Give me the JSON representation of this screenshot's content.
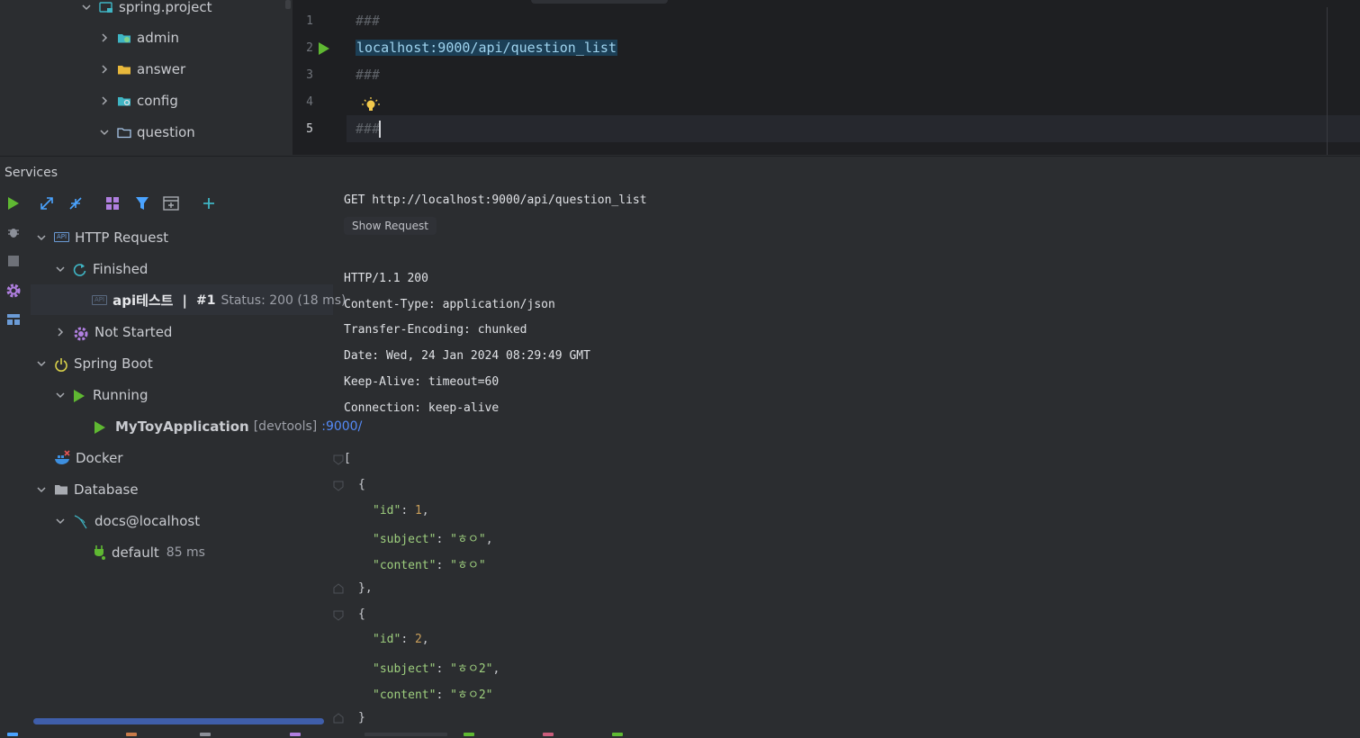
{
  "project_tree": {
    "items": [
      {
        "label": "spring.project",
        "expanded": true,
        "icon": "module-folder-icon"
      },
      {
        "label": "admin",
        "expanded": false,
        "icon": "package-folder-icon"
      },
      {
        "label": "answer",
        "expanded": false,
        "icon": "folder-icon"
      },
      {
        "label": "config",
        "expanded": false,
        "icon": "config-folder-icon"
      },
      {
        "label": "question",
        "expanded": true,
        "icon": "folder-outline-icon"
      }
    ]
  },
  "editor": {
    "line_numbers": [
      "1",
      "2",
      "3",
      "4",
      "5"
    ],
    "current_line": "5",
    "lines": [
      "###",
      "localhost:9000/api/question_list",
      "###",
      "",
      "###"
    ]
  },
  "services": {
    "title": "Services",
    "tree": {
      "http_request": "HTTP Request",
      "finished": "Finished",
      "api_test_name": "api테스트",
      "api_separator": "|",
      "api_run": "#1",
      "api_status": "Status: 200 (18 ms)",
      "not_started": "Not Started",
      "spring_boot": "Spring Boot",
      "running": "Running",
      "app_name": "MyToyApplication",
      "app_devtools": "[devtools]",
      "app_port": ":9000/",
      "docker": "Docker",
      "database": "Database",
      "db_connection": "docs@localhost",
      "db_default": "default",
      "db_time": "85 ms"
    }
  },
  "response": {
    "request_line": "GET http://localhost:9000/api/question_list",
    "show_request": "Show Request",
    "status_line": "HTTP/1.1 200",
    "headers": [
      "Content-Type: application/json",
      "Transfer-Encoding: chunked",
      "Date: Wed, 24 Jan 2024 08:29:49 GMT",
      "Keep-Alive: timeout=60",
      "Connection: keep-alive"
    ],
    "json": {
      "open_bracket": "[",
      "open_brace": "{",
      "close_brace_comma": "},",
      "close_brace": "}",
      "items": [
        {
          "id_key": "\"id\"",
          "id_val": "1",
          "subject_key": "\"subject\"",
          "subject_val": "\"ㅎㅇ\"",
          "content_key": "\"content\"",
          "content_val": "\"ㅎㅇ\""
        },
        {
          "id_key": "\"id\"",
          "id_val": "2",
          "subject_key": "\"subject\"",
          "subject_val": "\"ㅎㅇ2\"",
          "content_key": "\"content\"",
          "content_val": "\"ㅎㅇ2\""
        }
      ]
    }
  },
  "colors": {
    "background": "#2b2d30",
    "editor_background": "#1e1f22",
    "run_green": "#5fb832",
    "accent_blue": "#548af7",
    "json_string": "#9ecf7e",
    "json_number": "#c99f5b"
  }
}
